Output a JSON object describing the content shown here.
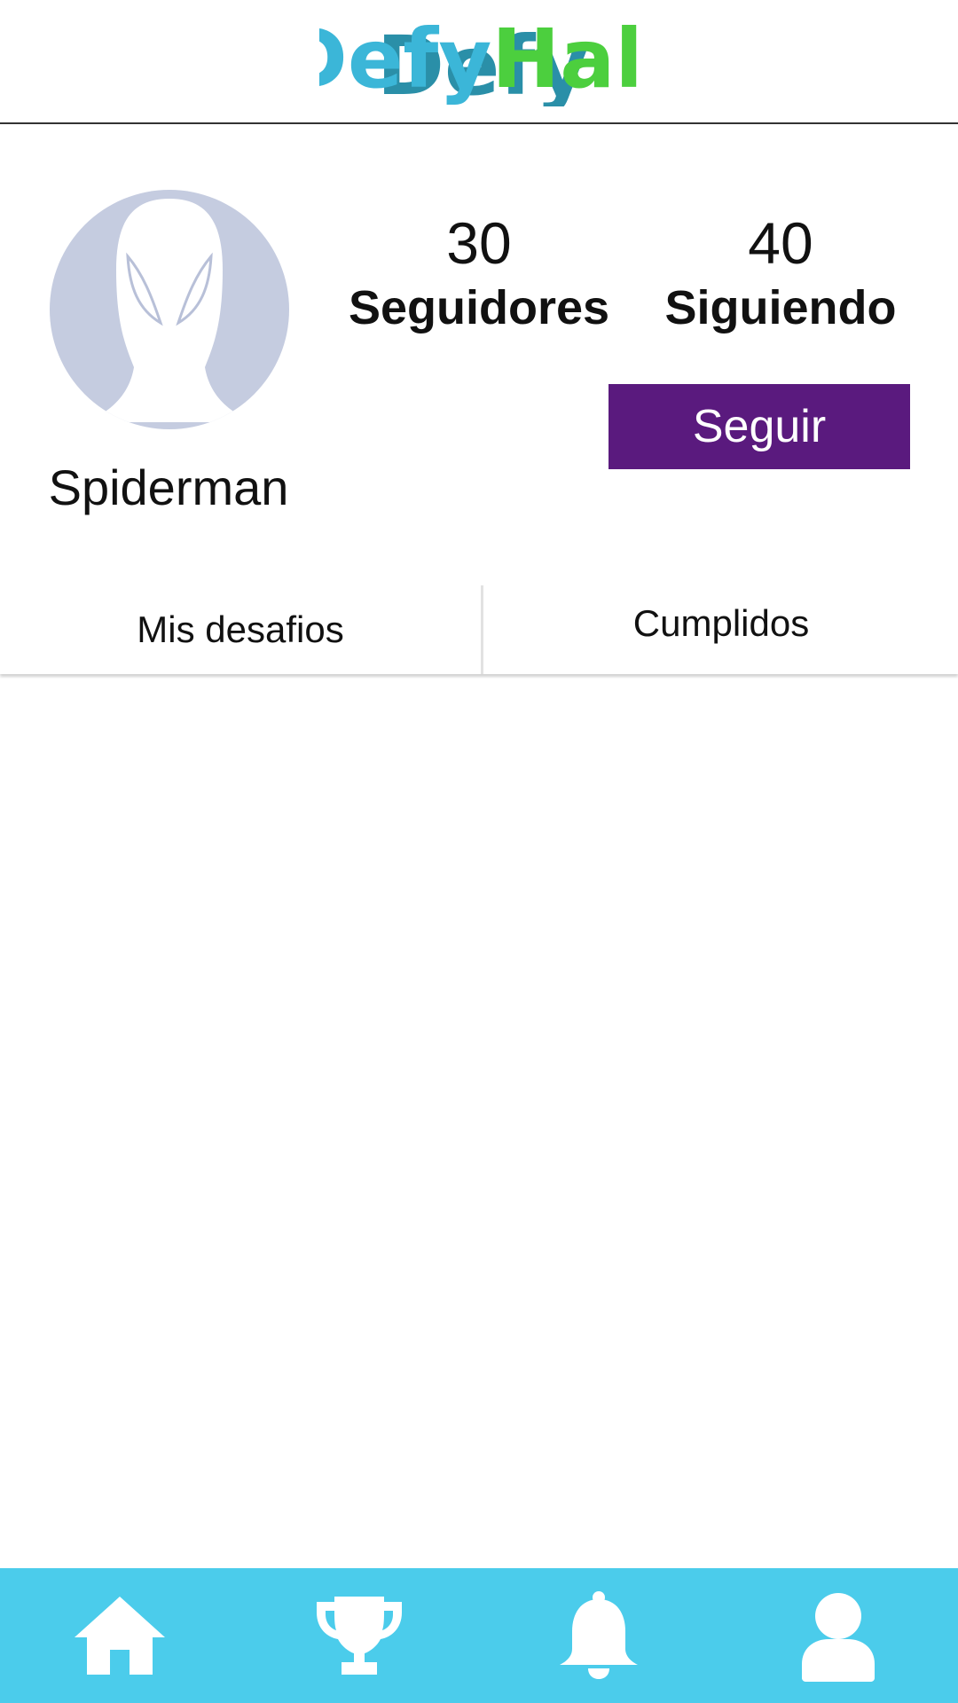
{
  "header": {
    "logo_part1": "Defy",
    "logo_part2": "Hall",
    "logo_color1": "#3bb6d8",
    "logo_color2": "#4ccf3e"
  },
  "profile": {
    "username": "Spiderman",
    "avatar_icon": "spiderman-mask-avatar",
    "followers_count": "30",
    "followers_label": "Seguidores",
    "following_count": "40",
    "following_label": "Siguiendo",
    "follow_button_label": "Seguir",
    "follow_button_color": "#5a1a7e"
  },
  "tabs": [
    {
      "label": "Mis desafios"
    },
    {
      "label": "Cumplidos"
    }
  ],
  "bottom_nav": {
    "background_color": "#4bcceb",
    "items": [
      {
        "icon": "home-icon"
      },
      {
        "icon": "trophy-icon"
      },
      {
        "icon": "bell-icon"
      },
      {
        "icon": "user-icon"
      }
    ]
  }
}
